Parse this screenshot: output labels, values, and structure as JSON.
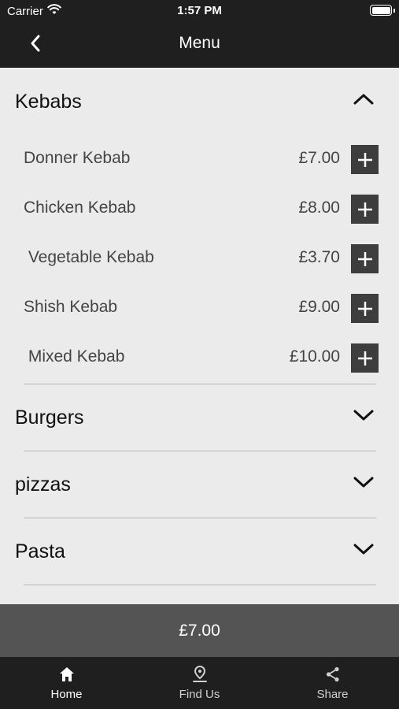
{
  "status_bar": {
    "carrier": "Carrier",
    "time": "1:57 PM"
  },
  "nav": {
    "title": "Menu"
  },
  "categories": [
    {
      "name": "Kebabs",
      "expanded": true,
      "items": [
        {
          "name": "Donner Kebab",
          "price": "£7.00"
        },
        {
          "name": "Chicken Kebab",
          "price": "£8.00"
        },
        {
          "name": " Vegetable Kebab",
          "price": "£3.70"
        },
        {
          "name": "Shish Kebab",
          "price": "£9.00"
        },
        {
          "name": " Mixed Kebab",
          "price": "£10.00"
        }
      ]
    },
    {
      "name": "Burgers",
      "expanded": false
    },
    {
      "name": "pizzas",
      "expanded": false
    },
    {
      "name": "Pasta",
      "expanded": false
    }
  ],
  "basket_total": "£7.00",
  "tabs": [
    {
      "label": "Home",
      "icon": "home-icon",
      "active": true
    },
    {
      "label": "Find Us",
      "icon": "location-pin-icon",
      "active": false
    },
    {
      "label": "Share",
      "icon": "share-icon",
      "active": false
    }
  ],
  "colors": {
    "bar_background": "#1f1f1f",
    "content_background": "#ebebeb",
    "add_button": "#3d3d3d",
    "total_bar": "#545454",
    "tab_active": "#ffffff",
    "tab_inactive": "#d0d0d0"
  }
}
